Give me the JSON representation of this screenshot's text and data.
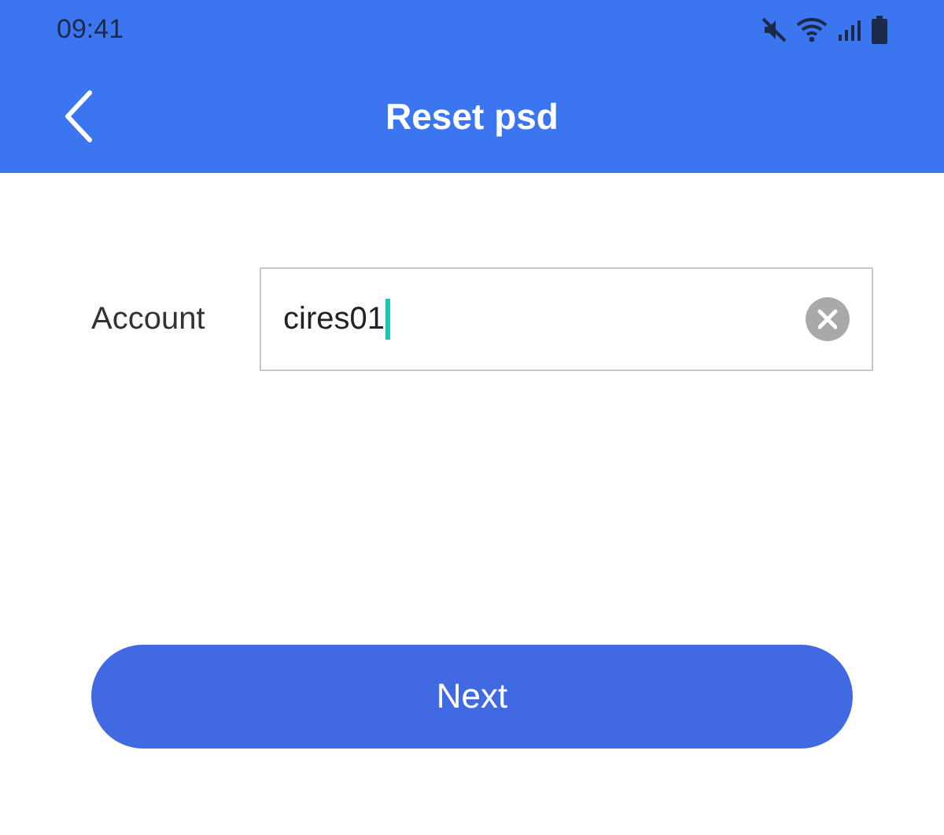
{
  "status_bar": {
    "time": "09:41"
  },
  "header": {
    "title": "Reset psd"
  },
  "form": {
    "label": "Account",
    "value": "cires01"
  },
  "buttons": [
    "Next"
  ]
}
